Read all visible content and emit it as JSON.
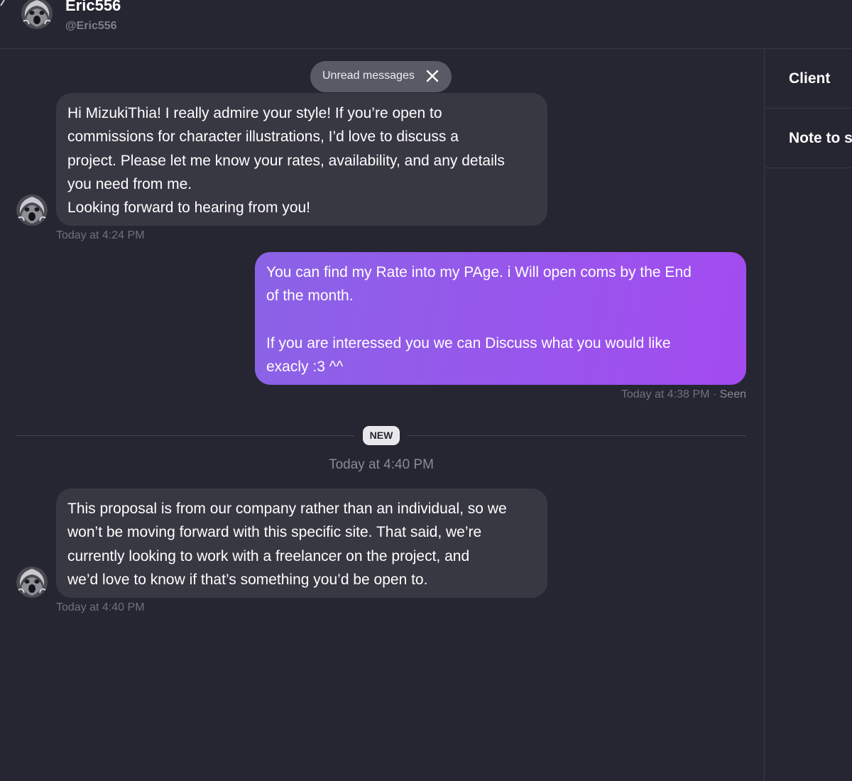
{
  "header": {
    "name": "Eric556",
    "handle": "@Eric556"
  },
  "right_panel": {
    "items": [
      "Client",
      "Note to s"
    ]
  },
  "chat": {
    "unread_label": "Unread messages",
    "messages": [
      {
        "direction": "incoming",
        "lines": [
          "Hi MizukiThia! I really admire your style! If you’re open to",
          "commissions for character illustrations, I’d love to discuss a",
          "project. Please let me know your rates, availability, and any details",
          "you need from me.",
          "Looking forward to hearing from you!"
        ],
        "time": "Today at 4:24 PM"
      },
      {
        "direction": "outgoing",
        "lines": [
          "You can find my Rate into my PAge. i Will open coms by the End",
          "of the month.",
          "",
          "If you are interessed you we can Discuss what you would like",
          "exacly :3 ^^"
        ],
        "time": "Today at 4:38 PM",
        "status": "Seen"
      },
      {
        "direction": "incoming",
        "lines": [
          "This proposal is from our company rather than an individual, so we",
          "won’t be moving forward with this specific site. That said, we’re",
          "currently looking to work with a freelancer on the project, and",
          "we’d love to know if that’s something you’d be open to."
        ],
        "time": "Today at 4:40 PM"
      }
    ],
    "new_badge": "NEW",
    "day_separator": "Today at 4:40 PM"
  },
  "colors": {
    "background": "#262632",
    "incoming_bubble": "#383843",
    "outgoing_gradient_start": "#8a63e6",
    "outgoing_gradient_end": "#a34bf0"
  }
}
